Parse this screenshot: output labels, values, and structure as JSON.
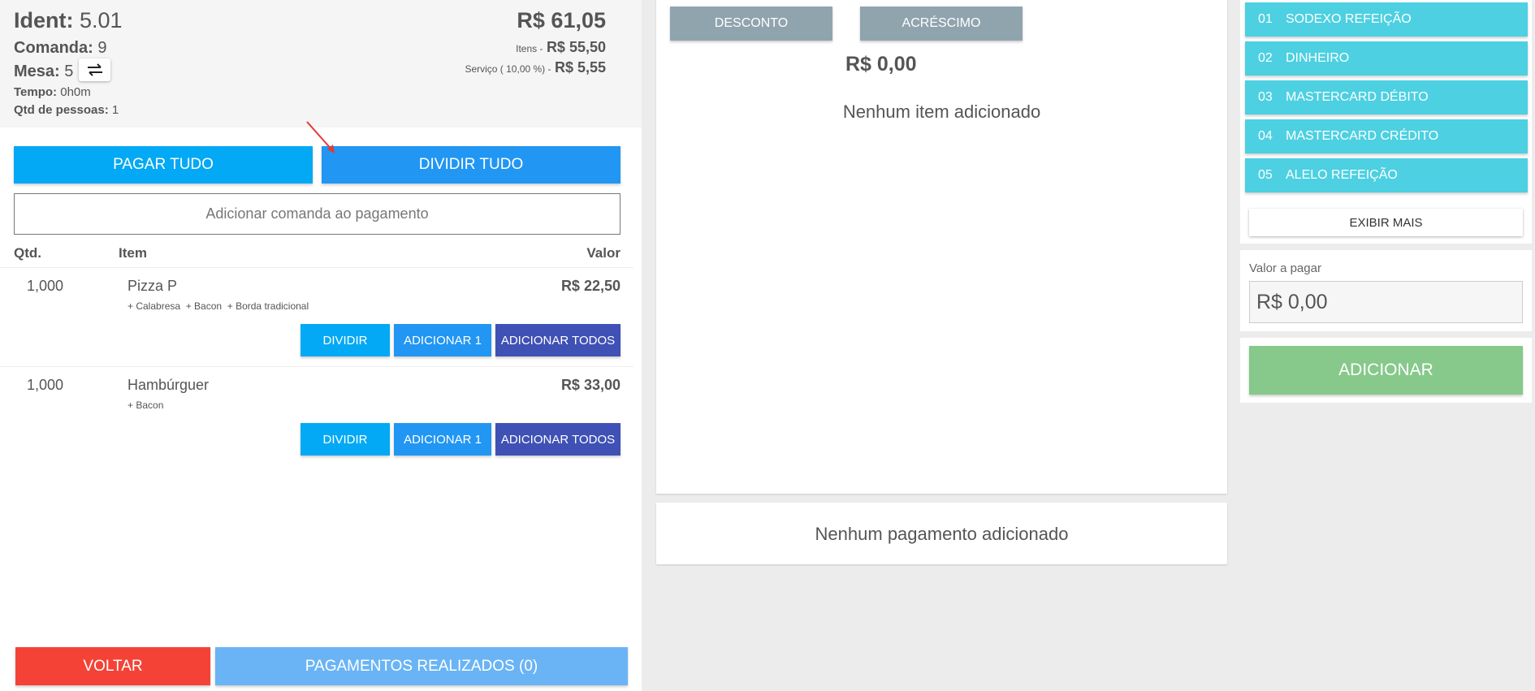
{
  "header": {
    "ident_label": "Ident:",
    "ident_value": "5.01",
    "comanda_label": "Comanda:",
    "comanda_value": "9",
    "mesa_label": "Mesa:",
    "mesa_value": "5",
    "tempo_label": "Tempo:",
    "tempo_value": "0h0m",
    "pessoas_label": "Qtd de pessoas:",
    "pessoas_value": "1",
    "total": "R$ 61,05",
    "itens_label": "Itens -",
    "itens_value": "R$ 55,50",
    "servico_label": "Serviço ( 10,00 %) -",
    "servico_value": "R$ 5,55"
  },
  "actions": {
    "pagar_tudo": "PAGAR TUDO",
    "dividir_tudo": "DIVIDIR TUDO",
    "adicionar_comanda": "Adicionar comanda ao pagamento"
  },
  "table": {
    "col_qtd": "Qtd.",
    "col_item": "Item",
    "col_valor": "Valor",
    "rows": [
      {
        "qtd": "1,000",
        "name": "Pizza P",
        "mods": "+ Calabresa  + Bacon  + Borda tradicional",
        "value": "R$ 22,50"
      },
      {
        "qtd": "1,000",
        "name": "Hambúrguer",
        "mods": "+ Bacon",
        "value": "R$ 33,00"
      }
    ],
    "btn_dividir": "DIVIDIR",
    "btn_adicionar1": "ADICIONAR 1",
    "btn_adicionar_todos": "ADICIONAR TODOS"
  },
  "footer": {
    "voltar": "VOLTAR",
    "pagamentos": "PAGAMENTOS REALIZADOS (0)"
  },
  "middle": {
    "desconto": "DESCONTO",
    "acrescimo": "ACRÉSCIMO",
    "value": "R$ 0,00",
    "empty_items": "Nenhum item adicionado",
    "empty_payments": "Nenhum pagamento adicionado"
  },
  "payments": {
    "methods": [
      {
        "code": "01",
        "name": "SODEXO REFEIÇÃO"
      },
      {
        "code": "02",
        "name": "DINHEIRO"
      },
      {
        "code": "03",
        "name": "MASTERCARD DÉBITO"
      },
      {
        "code": "04",
        "name": "MASTERCARD CRÉDITO"
      },
      {
        "code": "05",
        "name": "ALELO REFEIÇÃO"
      }
    ],
    "exibir_mais": "EXIBIR MAIS",
    "valor_label": "Valor a pagar",
    "valor_value": "R$ 0,00",
    "adicionar": "ADICIONAR"
  },
  "colors": {
    "primary_blue": "#03a9f4",
    "blue": "#2196f3",
    "indigo": "#3f51b5",
    "red": "#f44336",
    "cyan": "#4dd0e1",
    "green": "#86c98a",
    "gray": "#90a4ae"
  },
  "icons": {
    "swap": "swap-horizontal-icon",
    "annotation": "red-arrow-icon"
  }
}
